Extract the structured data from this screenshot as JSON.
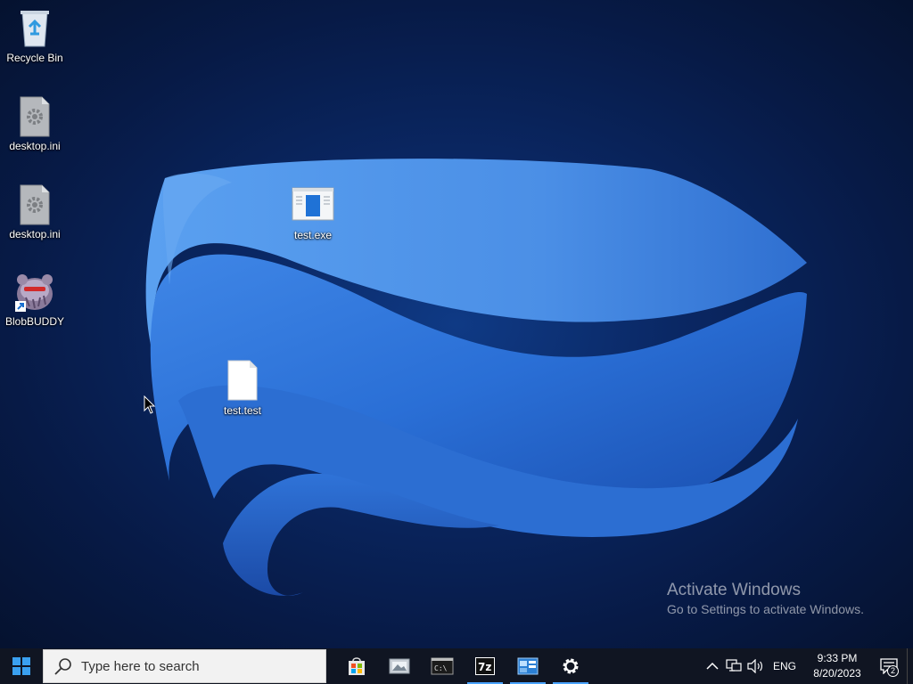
{
  "desktop": {
    "icons": [
      {
        "label": "Recycle Bin",
        "icon": "recycle-bin-icon"
      },
      {
        "label": "desktop.ini",
        "icon": "settings-file-icon"
      },
      {
        "label": "desktop.ini",
        "icon": "settings-file-icon"
      },
      {
        "label": "BlobBUDDY",
        "icon": "blobbuddy-shortcut-icon"
      },
      {
        "label": "test.exe",
        "icon": "executable-file-icon"
      },
      {
        "label": "test.test",
        "icon": "blank-file-icon"
      }
    ],
    "watermark": {
      "title": "Activate Windows",
      "subtitle": "Go to Settings to activate Windows."
    }
  },
  "taskbar": {
    "search_placeholder": "Type here to search",
    "apps": [
      {
        "name": "Microsoft Store",
        "icon": "store-icon",
        "active": false
      },
      {
        "name": "Photos Viewer",
        "icon": "image-viewer-icon",
        "active": false
      },
      {
        "name": "Command Prompt",
        "icon": "cmd-icon",
        "active": false
      },
      {
        "name": "7-Zip",
        "icon": "7zip-icon",
        "active": true,
        "text": "7z"
      },
      {
        "name": "Control Panel",
        "icon": "control-panel-icon",
        "active": true
      },
      {
        "name": "Settings",
        "icon": "gear-icon",
        "active": true
      }
    ],
    "tray": {
      "language": "ENG",
      "time": "9:33 PM",
      "date": "8/20/2023",
      "notification_count": "2"
    }
  },
  "colors": {
    "accent": "#4aa3ff",
    "taskbar": "#101522",
    "wallpaper_dark": "#071a46"
  }
}
